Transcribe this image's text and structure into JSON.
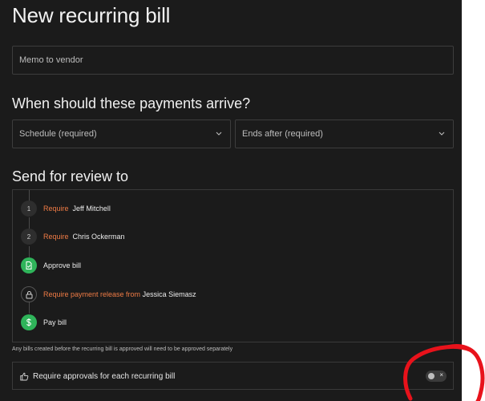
{
  "page": {
    "title": "New recurring bill"
  },
  "memo": {
    "placeholder": "Memo to vendor"
  },
  "payments": {
    "heading": "When should these payments arrive?",
    "schedule_label": "Schedule (required)",
    "ends_label": "Ends after (required)"
  },
  "review": {
    "heading": "Send for review to",
    "steps": [
      {
        "number": "1",
        "require": "Require",
        "name": "Jeff Mitchell"
      },
      {
        "number": "2",
        "require": "Require",
        "name": "Chris Ockerman"
      }
    ],
    "approve_label": "Approve bill",
    "release_require": "Require payment release from",
    "release_name": "Jessica Siemasz",
    "pay_label": "Pay bill"
  },
  "note": "Any bills created before the recurring bill is approved will need to be approved separately",
  "approvals": {
    "label": "Require approvals for each recurring bill",
    "toggle_state_glyph": "×",
    "enabled": false
  },
  "colors": {
    "panel_bg": "#1b1b1b",
    "accent_orange": "#ef7b45",
    "success_green": "#2fb45a",
    "annotation_red": "#e8121b"
  }
}
